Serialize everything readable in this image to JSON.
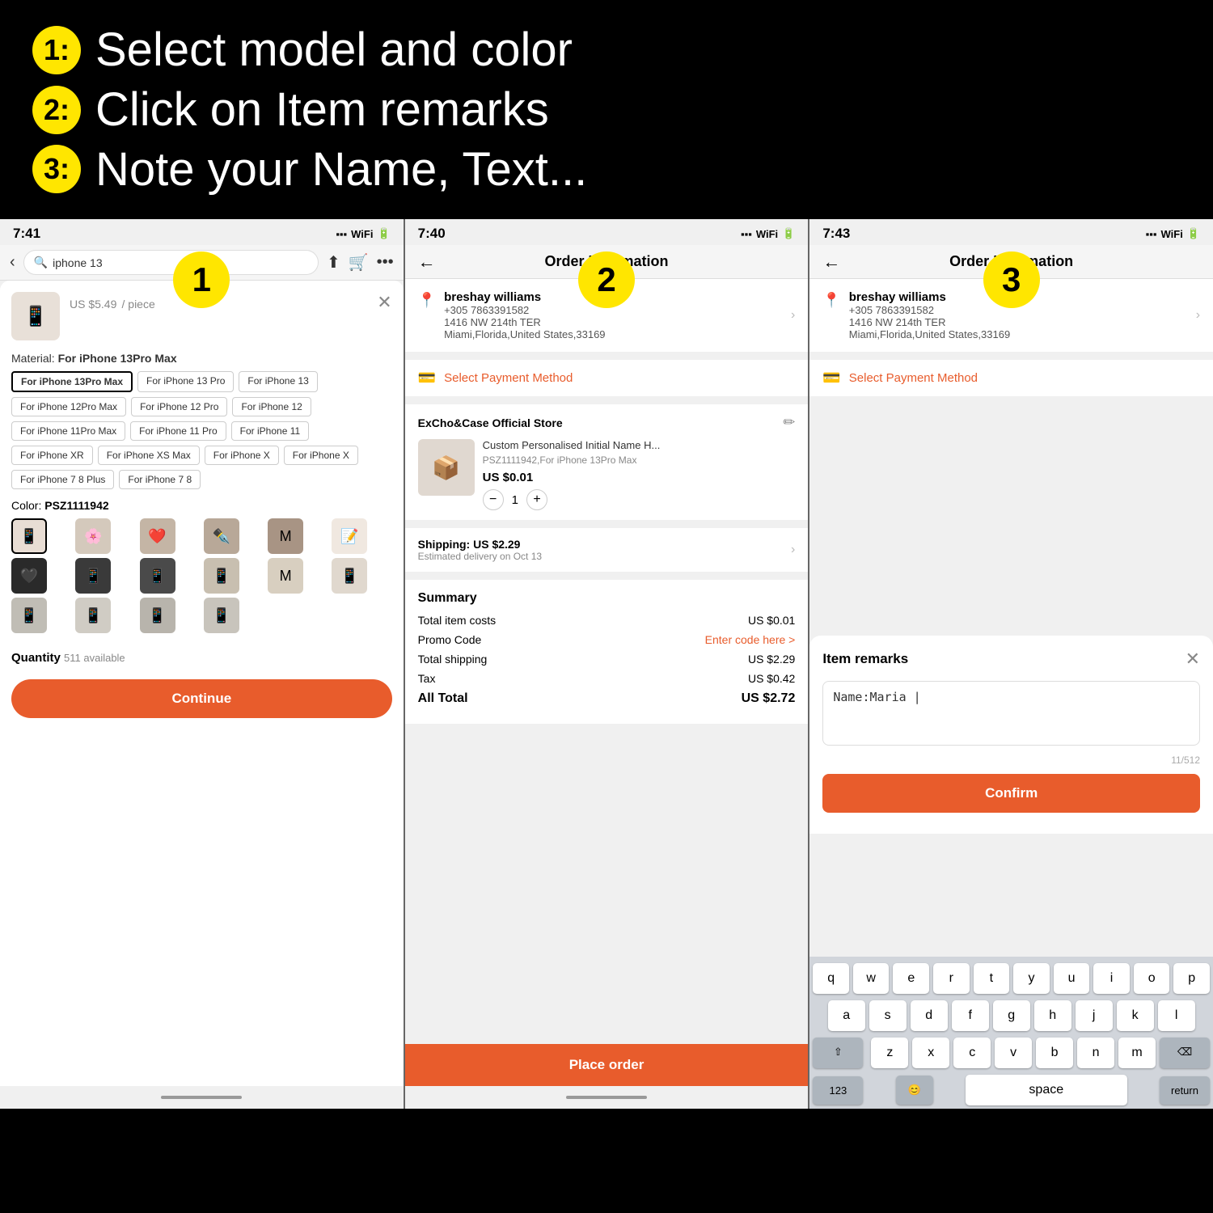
{
  "instructions": {
    "line1": "Select model and color",
    "line2": "Click on Item remarks",
    "line3": "Note your Name, Text..."
  },
  "phone1": {
    "status_time": "7:41",
    "search_placeholder": "iphone 13",
    "price": "US $5.49",
    "price_unit": "/ piece",
    "material_label": "Material:",
    "material_value": "For iPhone 13Pro Max",
    "tags": [
      {
        "label": "For iPhone 13Pro Max",
        "selected": true
      },
      {
        "label": "For iPhone 13 Pro",
        "selected": false
      },
      {
        "label": "For iPhone 13",
        "selected": false
      },
      {
        "label": "For iPhone 12Pro Max",
        "selected": false
      },
      {
        "label": "For iPhone 12 Pro",
        "selected": false
      },
      {
        "label": "For iPhone 12",
        "selected": false
      },
      {
        "label": "For iPhone 11Pro Max",
        "selected": false
      },
      {
        "label": "For iPhone 11 Pro",
        "selected": false
      },
      {
        "label": "For iPhone 11",
        "selected": false
      },
      {
        "label": "For iPhone XR",
        "selected": false
      },
      {
        "label": "For iPhone XS Max",
        "selected": false
      },
      {
        "label": "For iPhone X",
        "selected": false
      },
      {
        "label": "For iPhone X",
        "selected": false
      },
      {
        "label": "For iPhone 7 8 Plus",
        "selected": false
      },
      {
        "label": "For iPhone 7 8",
        "selected": false
      }
    ],
    "color_label": "Color:",
    "color_value": "PSZ1111942",
    "quantity_label": "Quantity",
    "available": "511 available",
    "continue_btn": "Continue",
    "circle_num": "1"
  },
  "phone2": {
    "status_time": "7:40",
    "header_title": "Order Information",
    "back_label": "←",
    "address": {
      "name": "breshay williams",
      "phone": "+305 7863391582",
      "street": "1416 NW 214th TER",
      "city": "Miami,Florida,United States,33169"
    },
    "payment_label": "Select Payment Method",
    "store_name": "ExCho&Case Official Store",
    "product_name": "Custom Personalised Initial Name H...",
    "product_variant": "PSZ1111942,For iPhone 13Pro Max",
    "product_price": "US $0.01",
    "product_qty": "1",
    "shipping_label": "Shipping: US $2.29",
    "shipping_detail": "Estimated delivery on Oct 13",
    "summary_title": "Summary",
    "total_items_label": "Total item costs",
    "total_items_value": "US $0.01",
    "promo_label": "Promo Code",
    "promo_value": "Enter code here >",
    "shipping_fee_label": "Total shipping",
    "shipping_fee_value": "US $2.29",
    "tax_label": "Tax",
    "tax_value": "US $0.42",
    "all_total_label": "All Total",
    "all_total_value": "US $2.72",
    "place_order_btn": "Place order",
    "circle_num": "2"
  },
  "phone3": {
    "status_time": "7:43",
    "header_title": "Order Information",
    "back_label": "←",
    "address": {
      "name": "breshay williams",
      "phone": "+305 7863391582",
      "street": "1416 NW 214th TER",
      "city": "Miami,Florida,United States,33169"
    },
    "payment_label": "Select Payment Method",
    "remarks_title": "Item remarks",
    "remarks_text": "Name:Maria |",
    "char_count": "11/512",
    "confirm_btn": "Confirm",
    "circle_num": "3",
    "keyboard": {
      "row1": [
        "q",
        "w",
        "e",
        "r",
        "t",
        "y",
        "u",
        "i",
        "o",
        "p"
      ],
      "row2": [
        "a",
        "s",
        "d",
        "f",
        "g",
        "h",
        "j",
        "k",
        "l"
      ],
      "row3": [
        "z",
        "x",
        "c",
        "v",
        "b",
        "n",
        "m"
      ],
      "bottom": [
        "123",
        "😊",
        "space",
        "return"
      ]
    }
  }
}
